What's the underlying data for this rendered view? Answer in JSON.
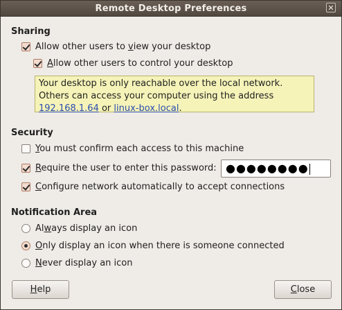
{
  "window": {
    "title": "Remote Desktop Preferences",
    "close_glyph": "✕"
  },
  "sharing": {
    "title": "Sharing",
    "allow_view": {
      "pre": "Allow other users to ",
      "key": "v",
      "post": "iew your desktop",
      "checked": true
    },
    "allow_control": {
      "key": "A",
      "post": "llow other users to control your desktop",
      "checked": true
    },
    "info": {
      "text1": "Your desktop is only reachable over the local network. Others can access your computer using the address ",
      "ip": "192.168.1.64",
      "or": " or ",
      "host": "linux-box.local",
      "end": "."
    }
  },
  "security": {
    "title": "Security",
    "confirm": {
      "key": "Y",
      "post": "ou must confirm each access to this machine",
      "checked": false
    },
    "require_pwd": {
      "key": "R",
      "post": "equire the user to enter this password:",
      "checked": true
    },
    "password_mask": "●●●●●●●●",
    "configure": {
      "key": "C",
      "post": "onfigure network automatically to accept connections",
      "checked": true
    }
  },
  "notification": {
    "title": "Notification Area",
    "always": {
      "pre": "Al",
      "key": "w",
      "post": "ays display an icon",
      "selected": false
    },
    "only": {
      "key": "O",
      "post": "nly display an icon when there is someone connected",
      "selected": true
    },
    "never": {
      "key": "N",
      "post": "ever display an icon",
      "selected": false
    }
  },
  "buttons": {
    "help": {
      "key": "H",
      "post": "elp"
    },
    "close": {
      "key": "C",
      "post": "lose"
    }
  }
}
